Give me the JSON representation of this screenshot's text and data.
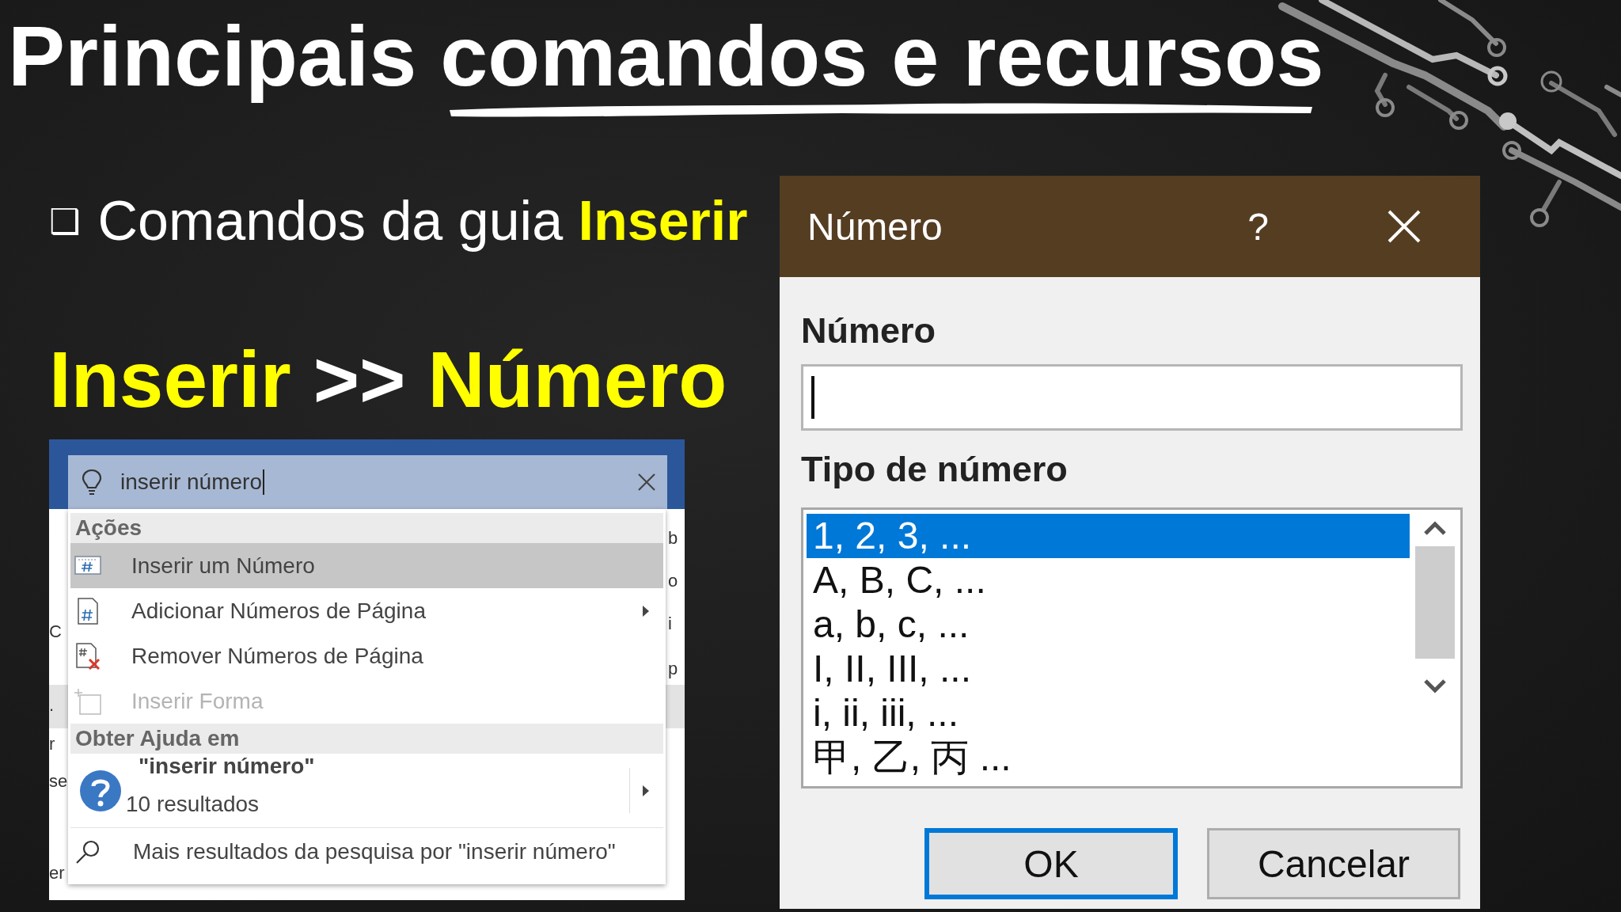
{
  "title": "Principais comandos e recursos",
  "bullet": {
    "marker": "❑",
    "text": "Comandos da guia **Inserir**"
  },
  "heading": {
    "parts": [
      {
        "text": "Inserir",
        "highlight": true
      },
      {
        "text": ">>",
        "highlight": false
      },
      {
        "text": "Número",
        "highlight": true
      }
    ]
  },
  "search_screenshot": {
    "query": "inserir número",
    "left_edge_text": [
      "C",
      ".",
      "r",
      "se",
      "er"
    ],
    "right_edge_text": [
      "b",
      "o",
      "i",
      "p"
    ],
    "sections": [
      {
        "header": "Ações",
        "items": [
          {
            "kind": "action",
            "label": "Inserir um Número",
            "selected": true,
            "disabled": false,
            "submenu": false
          },
          {
            "kind": "action",
            "label": "Adicionar Números de Página",
            "selected": false,
            "disabled": false,
            "submenu": true
          },
          {
            "kind": "action",
            "label": "Remover Números de Página",
            "selected": false,
            "disabled": false,
            "submenu": false
          },
          {
            "kind": "action",
            "label": "Inserir Forma",
            "selected": false,
            "disabled": true,
            "submenu": false
          }
        ]
      },
      {
        "header": "Obter Ajuda em",
        "items": [
          {
            "kind": "help",
            "title": "\"inserir número\"",
            "subtitle": "10 resultados",
            "submenu": true
          }
        ]
      }
    ],
    "more": "Mais resultados da pesquisa por \"inserir número\""
  },
  "dialog": {
    "title": "Número",
    "help": "?",
    "field_label": "Número",
    "list_label": "Tipo de número",
    "options": [
      {
        "label": "1, 2, 3, ...",
        "selected": true
      },
      {
        "label": "A, B, C, ...",
        "selected": false
      },
      {
        "label": "a, b, c, ...",
        "selected": false
      },
      {
        "label": "I, II, III, ...",
        "selected": false
      },
      {
        "label": "i, ii, iii, ...",
        "selected": false
      },
      {
        "label": "甲, 乙, 丙 ...",
        "selected": false
      }
    ],
    "buttons": [
      {
        "label": "OK",
        "default": true
      },
      {
        "label": "Cancelar",
        "default": false
      }
    ]
  }
}
